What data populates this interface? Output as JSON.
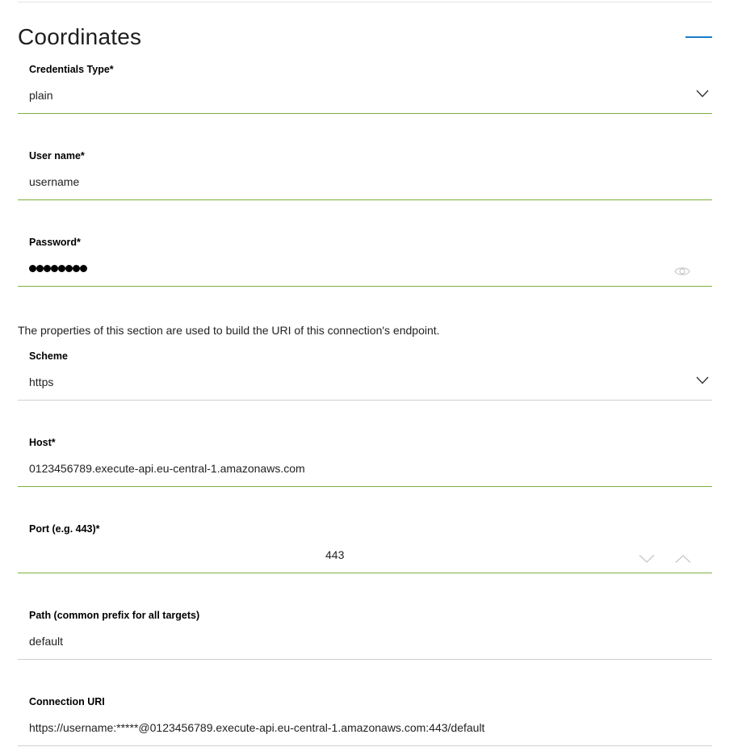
{
  "section": {
    "title": "Coordinates",
    "collapse_icon": "minus-icon",
    "accent_color": "#1b7bc6"
  },
  "credentials_type": {
    "label": "Credentials Type*",
    "value": "plain",
    "icon": "chevron-down-icon"
  },
  "user_name": {
    "label": "User name*",
    "value": "username"
  },
  "password": {
    "label": "Password*",
    "masked_length": 8,
    "icon": "eye-icon"
  },
  "helper_text": "The properties of this section are used to build the URI of this connection's endpoint.",
  "scheme": {
    "label": "Scheme",
    "value": "https",
    "icon": "chevron-down-icon"
  },
  "host": {
    "label": "Host*",
    "value": "0123456789.execute-api.eu-central-1.amazonaws.com"
  },
  "port": {
    "label": "Port (e.g. 443)*",
    "value": "443",
    "decrement_icon": "chevron-down-icon",
    "increment_icon": "chevron-up-icon"
  },
  "path": {
    "label": "Path (common prefix for all targets)",
    "value": "default"
  },
  "connection_uri": {
    "label": "Connection URI",
    "value": "https://username:*****@0123456789.execute-api.eu-central-1.amazonaws.com:443/default"
  },
  "colors": {
    "valid_underline": "#7eb03d",
    "neutral_underline": "#cfcfcf"
  }
}
